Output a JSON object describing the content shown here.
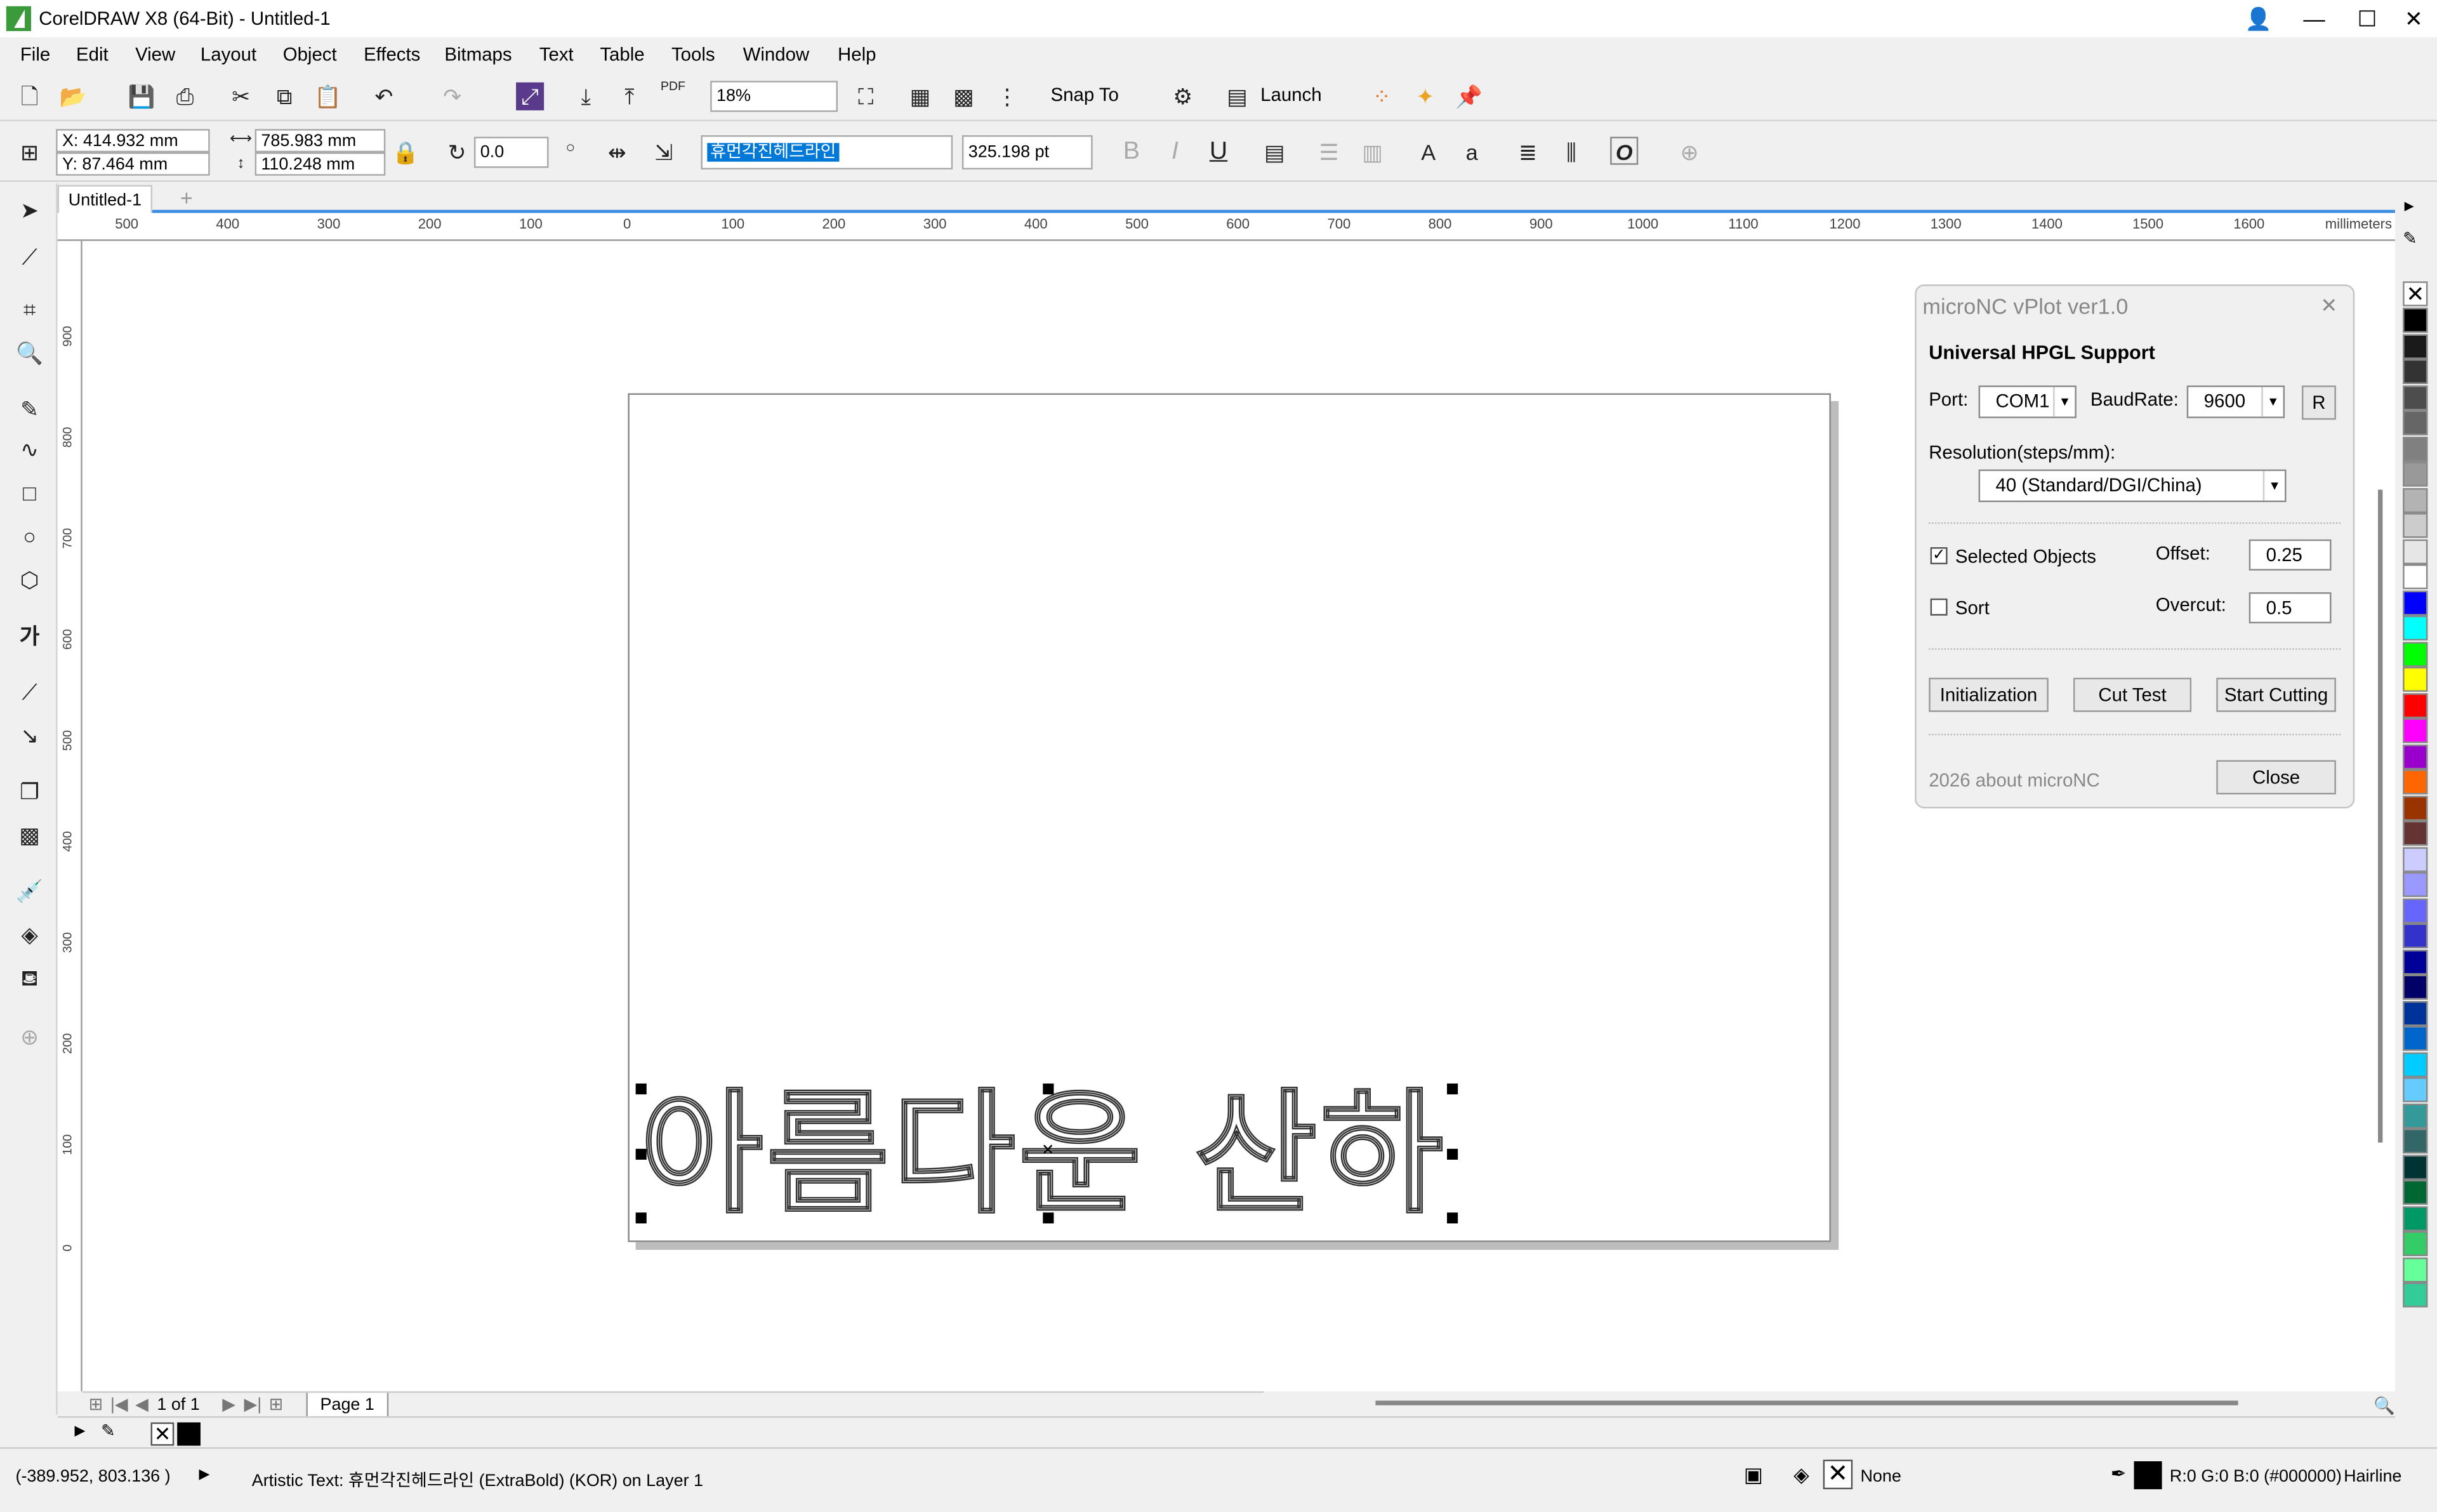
{
  "window": {
    "title": "CorelDRAW X8 (64-Bit) - Untitled-1",
    "min": "—",
    "max": "☐",
    "close": "✕"
  },
  "menu": [
    "File",
    "Edit",
    "View",
    "Layout",
    "Object",
    "Effects",
    "Bitmaps",
    "Text",
    "Table",
    "Tools",
    "Window",
    "Help"
  ],
  "toolbar": {
    "zoom": "18%",
    "snap": "Snap To",
    "launch": "Launch",
    "pdf": "PDF"
  },
  "property": {
    "x": "X: 414.932 mm",
    "y": "Y: 87.464 mm",
    "w": "785.983 mm",
    "h": "110.248 mm",
    "angle": "0.0",
    "font": "휴먼각진헤드라인",
    "size": "325.198 pt",
    "bold": "B",
    "italic": "I",
    "underline": "U",
    "frame": "O"
  },
  "doc": {
    "tab": "Untitled-1",
    "plus": "+"
  },
  "ruler": {
    "unit": "millimeters",
    "h": [
      "500",
      "400",
      "300",
      "200",
      "100",
      "0",
      "100",
      "200",
      "300",
      "400",
      "500",
      "600",
      "700",
      "800",
      "900",
      "1000",
      "1100",
      "1200",
      "1300",
      "1400",
      "1500",
      "1600"
    ],
    "v": [
      "900",
      "800",
      "700",
      "600",
      "500",
      "400",
      "300",
      "200",
      "100",
      "0"
    ]
  },
  "canvas": {
    "text": "아름다운 산하"
  },
  "pagenav": {
    "count": "1 of 1",
    "page": "Page 1"
  },
  "docker": {
    "title": "microNC  vPlot ver1.0",
    "close": "✕",
    "heading": "Universal HPGL Support",
    "port_label": "Port:",
    "port": "COM1",
    "baud_label": "BaudRate:",
    "baud": "9600",
    "r_btn": "R",
    "res_label": "Resolution(steps/mm):",
    "res": "40 (Standard/DGI/China)",
    "selected_label": "Selected Objects",
    "offset_label": "Offset:",
    "offset": "0.25",
    "sort_label": "Sort",
    "overcut_label": "Overcut:",
    "overcut": "0.5",
    "btn_init": "Initialization",
    "btn_cut": "Cut Test",
    "btn_start": "Start Cutting",
    "about": "2026 about microNC",
    "btn_close": "Close"
  },
  "status": {
    "coords": "(-389.952, 803.136 )",
    "info": "Artistic Text: 휴먼각진헤드라인 (ExtraBold) (KOR) on Layer 1",
    "fill": "None",
    "outline": "R:0 G:0 B:0 (#000000)",
    "hairline": "Hairline"
  },
  "palette": [
    "#000000",
    "#1a1a1a",
    "#333333",
    "#4d4d4d",
    "#666666",
    "#808080",
    "#999999",
    "#b3b3b3",
    "#cccccc",
    "#e6e6e6",
    "#ffffff",
    "#0000ff",
    "#00ffff",
    "#00ff00",
    "#ffff00",
    "#ff0000",
    "#ff00ff",
    "#9900cc",
    "#ff6600",
    "#993300",
    "#663333",
    "#ccccff",
    "#9999ff",
    "#6666ff",
    "#3333cc",
    "#000099",
    "#000066",
    "#003399",
    "#0066cc",
    "#00ccff",
    "#66ccff",
    "#339999",
    "#336666",
    "#003333",
    "#006633",
    "#009966",
    "#33cc66",
    "#66ff99",
    "#33cc99"
  ]
}
